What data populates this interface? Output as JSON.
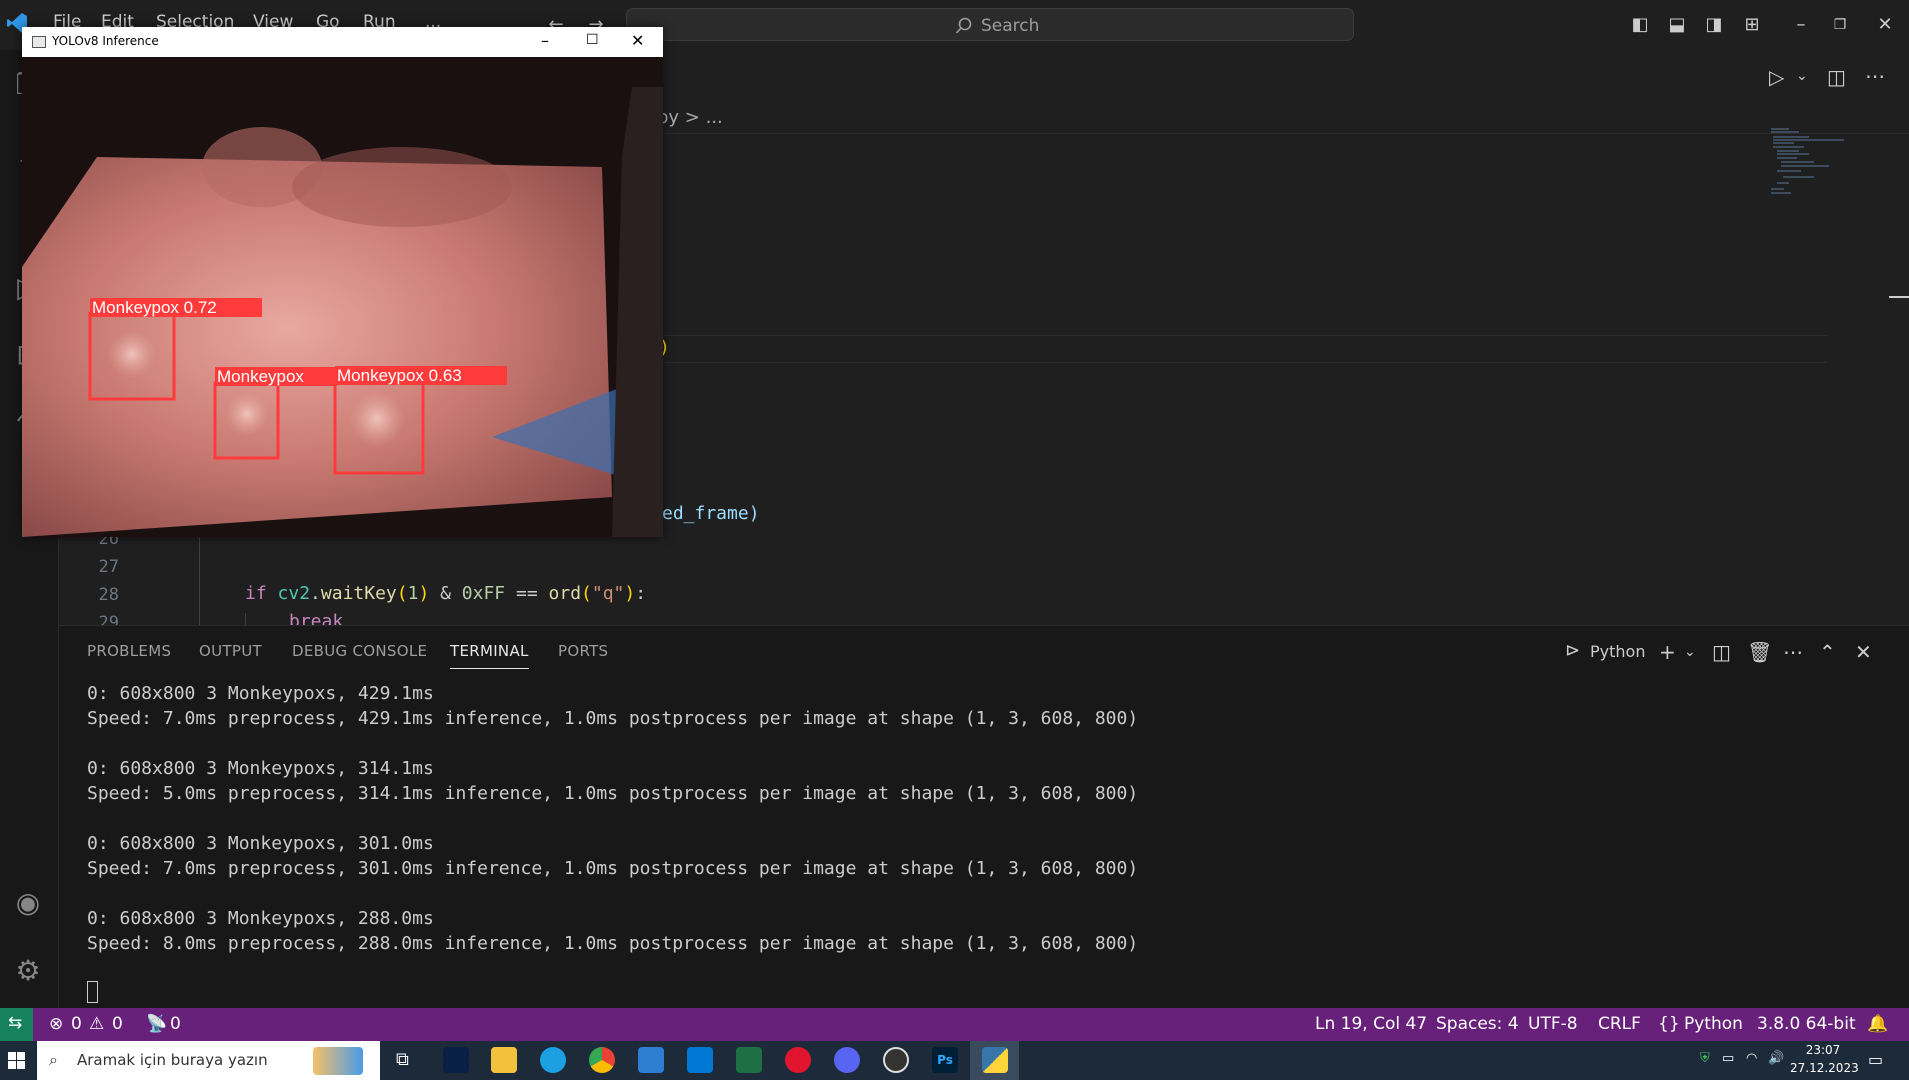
{
  "titlebar": {
    "menu": [
      "File",
      "Edit",
      "Selection",
      "View",
      "Go",
      "Run",
      "..."
    ],
    "search_placeholder": "Search"
  },
  "editor": {
    "breadcrumb": "py  >  ...",
    "visible_fragments": [
      ")",
      "ed_frame)"
    ],
    "lines": [
      {
        "num": "26",
        "code": ""
      },
      {
        "num": "27",
        "code": ""
      },
      {
        "num": "28",
        "code": "    if cv2.waitKey(1) & 0xFF == ord(\"q\"):"
      },
      {
        "num": "29",
        "code": "        break"
      }
    ]
  },
  "panel": {
    "tabs": [
      "PROBLEMS",
      "OUTPUT",
      "DEBUG CONSOLE",
      "TERMINAL",
      "PORTS"
    ],
    "active_tab": "TERMINAL",
    "terminal_profile": "Python",
    "terminal_lines": [
      "0: 608x800 3 Monkeypoxs, 429.1ms",
      "Speed: 7.0ms preprocess, 429.1ms inference, 1.0ms postprocess per image at shape (1, 3, 608, 800)",
      "",
      "0: 608x800 3 Monkeypoxs, 314.1ms",
      "Speed: 5.0ms preprocess, 314.1ms inference, 1.0ms postprocess per image at shape (1, 3, 608, 800)",
      "",
      "0: 608x800 3 Monkeypoxs, 301.0ms",
      "Speed: 7.0ms preprocess, 301.0ms inference, 1.0ms postprocess per image at shape (1, 3, 608, 800)",
      "",
      "0: 608x800 3 Monkeypoxs, 288.0ms",
      "Speed: 8.0ms preprocess, 288.0ms inference, 1.0ms postprocess per image at shape (1, 3, 608, 800)"
    ]
  },
  "statusbar": {
    "errors": "0",
    "warnings": "0",
    "ports": "0",
    "position": "Ln 19, Col 47",
    "spaces": "Spaces: 4",
    "encoding": "UTF-8",
    "eol": "CRLF",
    "language": "Python",
    "interpreter": "3.8.0 64-bit"
  },
  "taskbar": {
    "search_placeholder": "Aramak için buraya yazın",
    "time": "23:07",
    "date": "27.12.2023"
  },
  "yolo_window": {
    "title": "YOLOv8 Inference",
    "detections": [
      {
        "label": "Monkeypox 0.72"
      },
      {
        "label": "Monkeypox"
      },
      {
        "label": "Monkeypox 0.63"
      }
    ]
  },
  "colors": {
    "status_bar": "#68217a",
    "remote": "#16825d",
    "box": "#ff3a3a"
  }
}
